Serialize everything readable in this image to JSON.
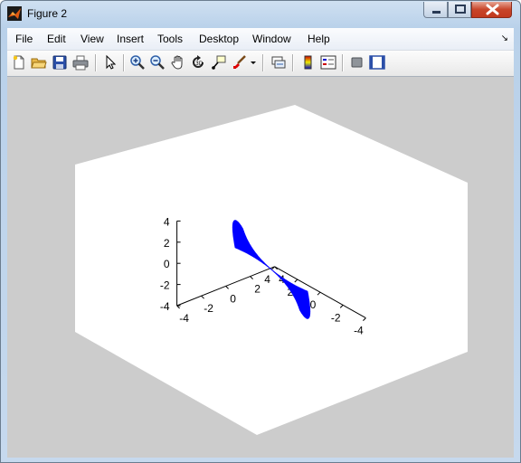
{
  "window": {
    "title": "Figure 2"
  },
  "menu": [
    "File",
    "Edit",
    "View",
    "Insert",
    "Tools",
    "Desktop",
    "Window",
    "Help"
  ],
  "toolbar": {
    "group1": [
      "new-figure-icon",
      "open-file-icon",
      "save-icon",
      "print-icon"
    ],
    "group2": [
      "edit-plot-arrow-icon"
    ],
    "group3": [
      "zoom-in-icon",
      "zoom-out-icon",
      "pan-hand-icon",
      "rotate-3d-icon",
      "data-cursor-icon",
      "brush-icon",
      "brush-dropdown-icon"
    ],
    "group4": [
      "link-plot-icon"
    ],
    "group5": [
      "insert-colorbar-icon",
      "insert-legend-icon"
    ],
    "group6": [
      "hide-plot-tools-icon",
      "show-plot-tools-icon"
    ]
  },
  "colors": {
    "figure_bg": "#cccccc",
    "axes_bg": "#ffffff",
    "surface": "#0000ff"
  },
  "chart_data": {
    "type": "surface3d",
    "description_series": "two-lobed blue surface (bowtie) through origin",
    "xlim": [
      -4,
      4
    ],
    "ylim": [
      -4,
      4
    ],
    "zlim": [
      -4,
      4
    ],
    "x_ticks": [
      "-4",
      "-2",
      "0",
      "2",
      "4"
    ],
    "y_ticks": [
      "-4",
      "-2",
      "0",
      "2",
      "4"
    ],
    "z_ticks": [
      "-4",
      "-2",
      "0",
      "2",
      "4"
    ],
    "grid": false,
    "title": "",
    "xlabel": "",
    "ylabel": "",
    "zlabel": ""
  }
}
